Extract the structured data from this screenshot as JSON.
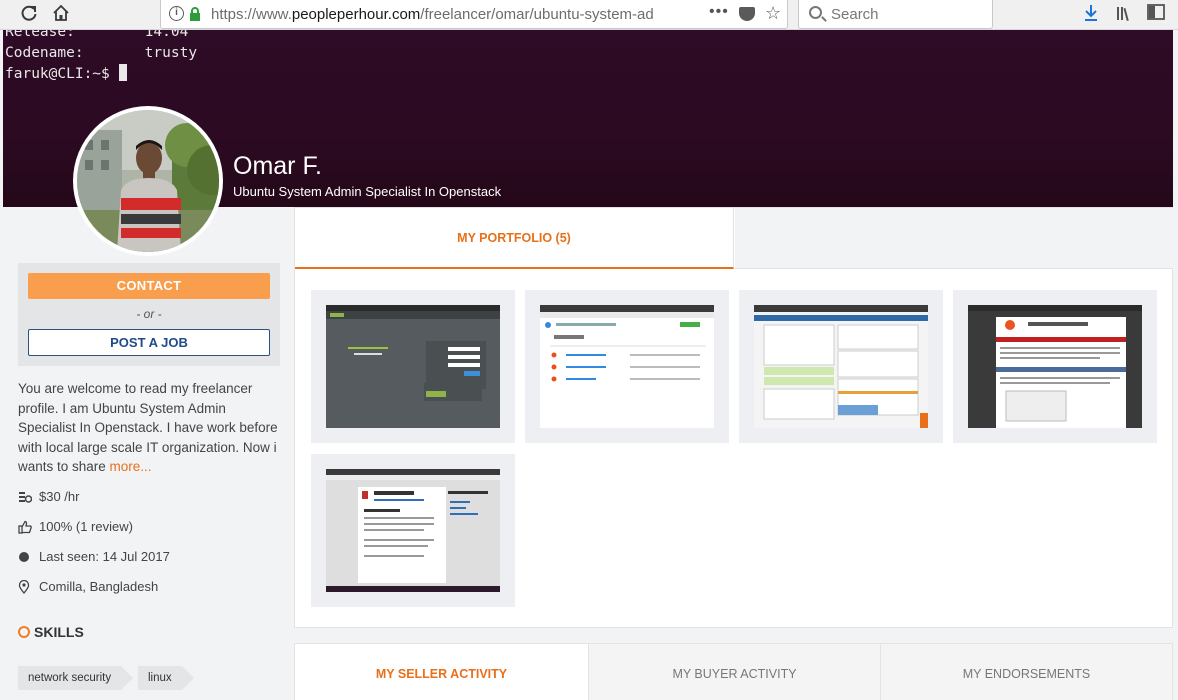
{
  "browser": {
    "url_prefix": "https://www.",
    "url_domain": "peopleperhour.com",
    "url_path": "/freelancer/omar/ubuntu-system-ad",
    "menu_dots": "•••",
    "search_placeholder": "Search"
  },
  "terminal": {
    "line1": "Release:        14.04",
    "line2": "Codename:       trusty",
    "prompt": "faruk@CLI:~$ "
  },
  "profile": {
    "name": "Omar F.",
    "headline": "Ubuntu System Admin Specialist In Openstack"
  },
  "actions": {
    "contact_label": "CONTACT",
    "or_label": "- or -",
    "post_job_label": "POST A JOB"
  },
  "about": {
    "text": "You are welcome to read my freelancer profile. I am Ubuntu System Admin Specialist In Openstack. I have work before with local large scale IT organization. Now i wants to share ",
    "more_label": "more..."
  },
  "facts": {
    "rate": "$30 /hr",
    "rating": "100% (1 review)",
    "last_seen": "Last seen: 14 Jul 2017",
    "location": "Comilla, Bangladesh"
  },
  "skills": {
    "title": "SKILLS",
    "items": [
      "network security",
      "linux"
    ]
  },
  "portfolio": {
    "tab_label": "MY PORTFOLIO (5)"
  },
  "activity_tabs": {
    "seller": "MY SELLER ACTIVITY",
    "buyer": "MY BUYER ACTIVITY",
    "endorsements": "MY ENDORSEMENTS"
  },
  "colors": {
    "accent": "#e8701a",
    "contact_button": "#f99e4d",
    "post_job_border": "#2c4f86",
    "cover": "#2d0b24"
  }
}
